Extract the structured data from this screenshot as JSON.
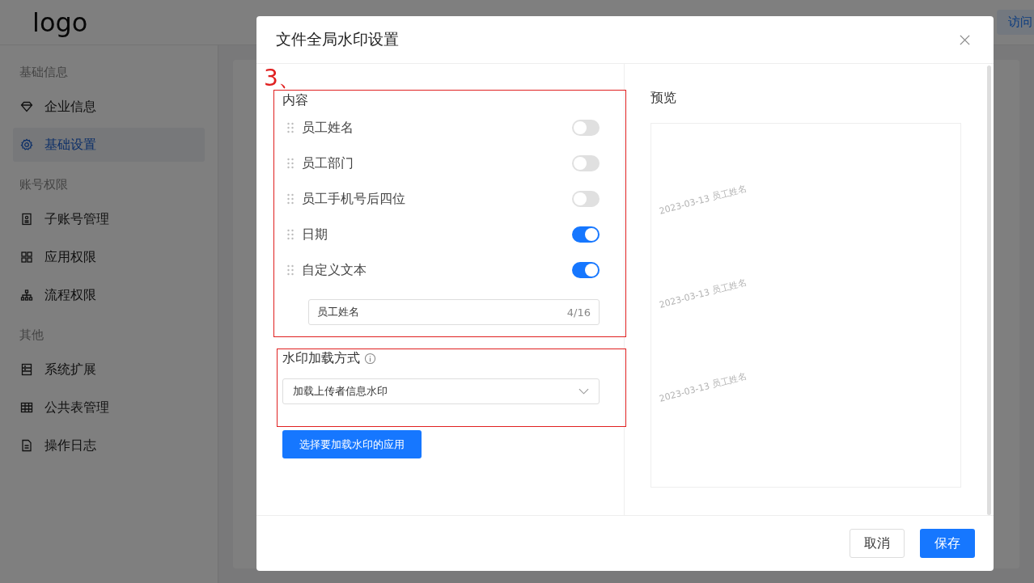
{
  "header": {
    "logo": "logo",
    "visit_button": "访问"
  },
  "sidebar": {
    "groups": [
      {
        "title": "基础信息",
        "items": [
          {
            "label": "企业信息",
            "selected": false
          },
          {
            "label": "基础设置",
            "selected": true
          }
        ]
      },
      {
        "title": "账号权限",
        "items": [
          {
            "label": "子账号管理",
            "selected": false
          },
          {
            "label": "应用权限",
            "selected": false
          },
          {
            "label": "流程权限",
            "selected": false
          }
        ]
      },
      {
        "title": "其他",
        "items": [
          {
            "label": "系统扩展",
            "selected": false
          },
          {
            "label": "公共表管理",
            "selected": false
          },
          {
            "label": "操作日志",
            "selected": false
          }
        ]
      }
    ]
  },
  "dialog": {
    "title": "文件全局水印设置",
    "annotation": "3、",
    "content": {
      "title": "内容",
      "items": [
        {
          "label": "员工姓名",
          "on": false
        },
        {
          "label": "员工部门",
          "on": false
        },
        {
          "label": "员工手机号后四位",
          "on": false
        },
        {
          "label": "日期",
          "on": true
        },
        {
          "label": "自定义文本",
          "on": true
        }
      ],
      "custom_text": {
        "value": "员工姓名",
        "count": "4/16"
      }
    },
    "load_mode": {
      "title": "水印加载方式",
      "value": "加载上传者信息水印"
    },
    "apply_button": "选择要加载水印的应用",
    "preview": {
      "title": "预览",
      "watermarks": [
        "2023-03-13 员工姓名",
        "2023-03-13 员工姓名",
        "2023-03-13 员工姓名"
      ]
    },
    "buttons": [
      {
        "label": "取消",
        "kind": "secondary"
      },
      {
        "label": "保存",
        "kind": "primary"
      }
    ]
  }
}
